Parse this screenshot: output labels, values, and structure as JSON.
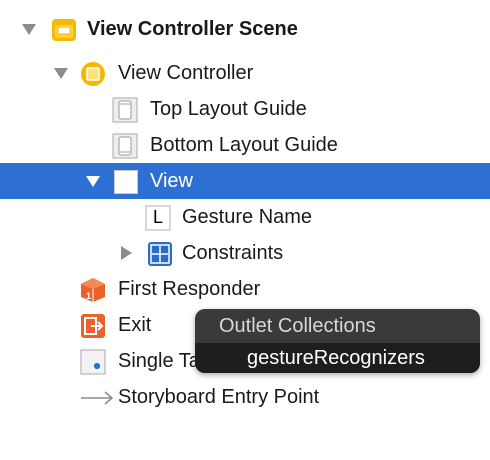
{
  "outline": {
    "scene": {
      "label": "View Controller Scene",
      "expanded": true,
      "icon": "scene-icon"
    },
    "view_controller": {
      "label": "View Controller",
      "expanded": true,
      "icon": "view-controller-icon"
    },
    "top_layout_guide": {
      "label": "Top Layout Guide",
      "icon": "layout-guide-icon"
    },
    "bottom_layout_guide": {
      "label": "Bottom Layout Guide",
      "icon": "layout-guide-icon"
    },
    "view": {
      "label": "View",
      "expanded": true,
      "selected": true,
      "icon": "view-icon"
    },
    "gesture_name": {
      "label": "Gesture Name",
      "icon": "label-icon",
      "icon_glyph": "L"
    },
    "constraints": {
      "label": "Constraints",
      "expanded": false,
      "icon": "constraints-icon"
    },
    "first_responder": {
      "label": "First Responder",
      "icon": "first-responder-icon"
    },
    "exit": {
      "label": "Exit",
      "icon": "exit-icon"
    },
    "single_tap": {
      "label": "Single Tap",
      "icon": "tap-gesture-icon"
    },
    "entry_point": {
      "label": "Storyboard Entry Point",
      "icon": "arrow-icon"
    }
  },
  "tooltip": {
    "header": "Outlet Collections",
    "item": "gestureRecognizers"
  },
  "colors": {
    "selection": "#2e6fd3",
    "scene_yellow": "#f5b800",
    "constraint_blue": "#2a6cc8",
    "first_responder_orange": "#e8622a",
    "exit_orange": "#e8622a",
    "tooltip_bg": "#3a3a3a"
  }
}
